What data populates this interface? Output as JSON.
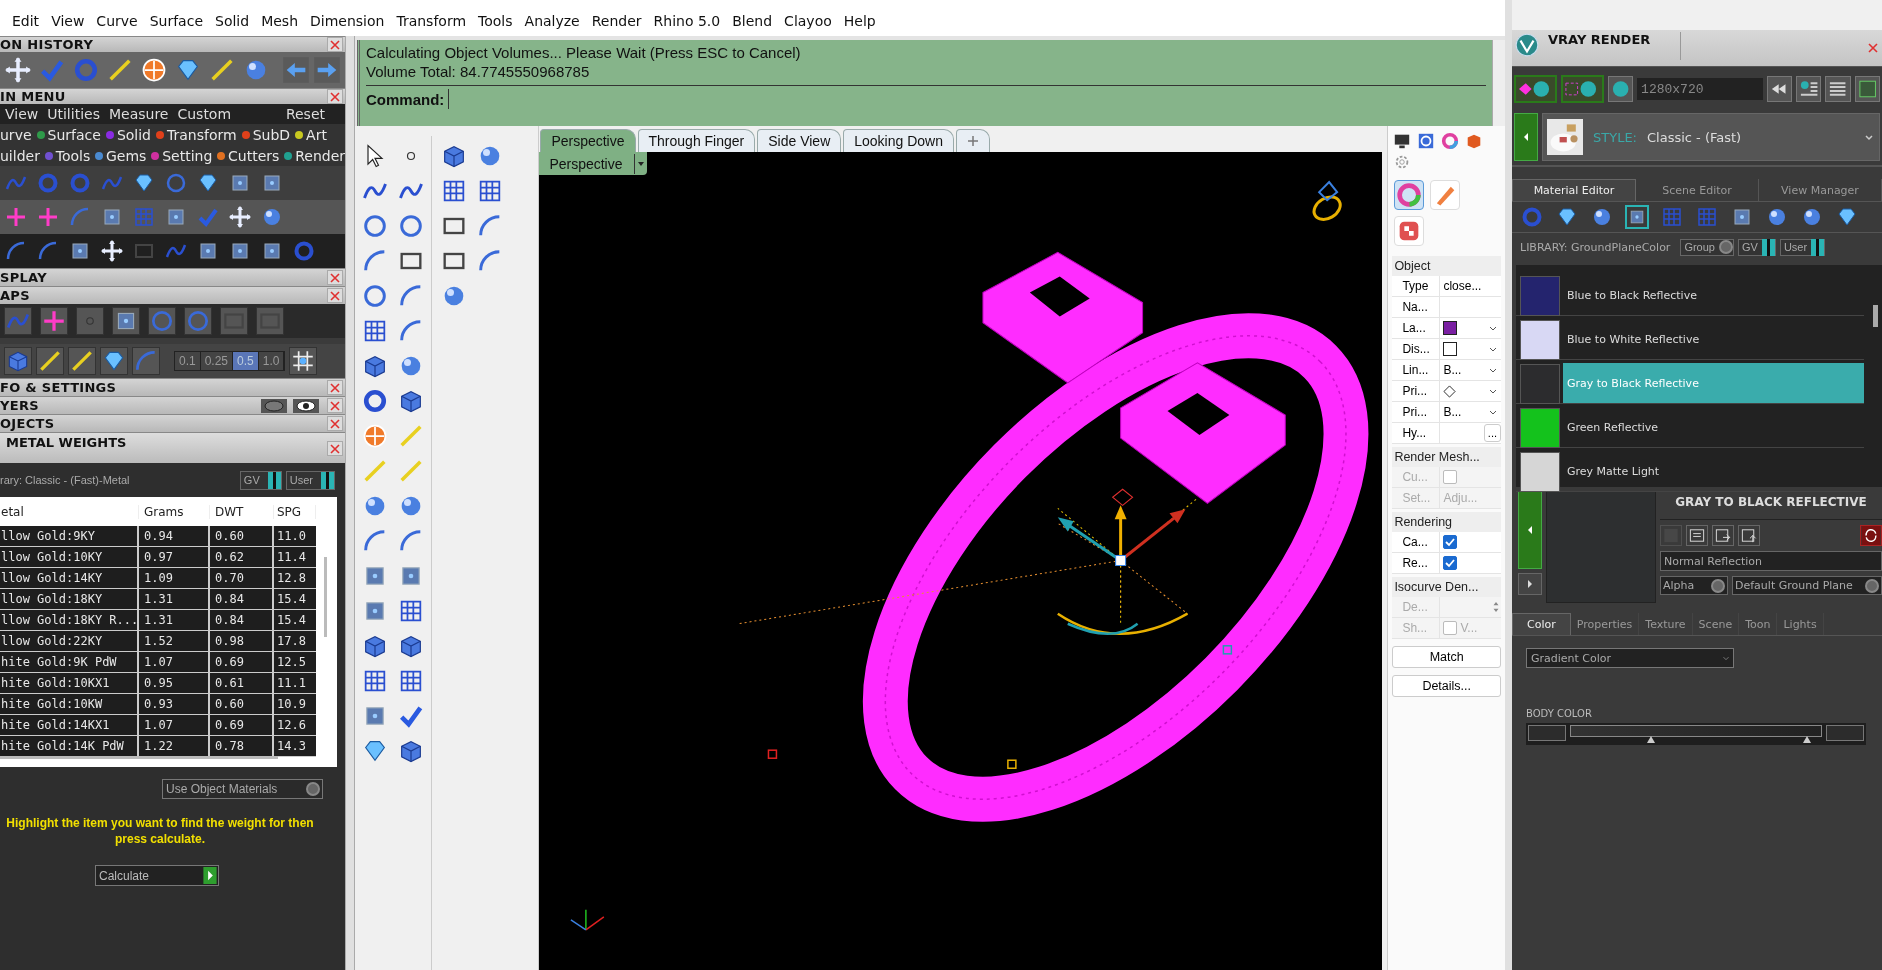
{
  "menu_bar": [
    "Edit",
    "View",
    "Curve",
    "Surface",
    "Solid",
    "Mesh",
    "Dimension",
    "Transform",
    "Tools",
    "Analyze",
    "Render",
    "Rhino 5.0",
    "Blend",
    "Clayoo",
    "Help"
  ],
  "history_panel": {
    "title": "ON HISTORY"
  },
  "main_menu": {
    "title": "IN MENU",
    "menus": [
      "View",
      "Utilities",
      "Measure",
      "Custom"
    ],
    "reset": "Reset",
    "categories": [
      [
        {
          "label": "urve"
        },
        {
          "label": "Surface",
          "color": "#2f9a4a"
        },
        {
          "label": "Solid",
          "color": "#8a2be2"
        },
        {
          "label": "Transform",
          "color": "#e0401a"
        },
        {
          "label": "SubD",
          "color": "#e0401a"
        },
        {
          "label": "Art",
          "color": "#c8c820"
        }
      ],
      [
        {
          "label": "uilder"
        },
        {
          "label": "Tools",
          "color": "#7050d0"
        },
        {
          "label": "Gems",
          "color": "#4a8ad0"
        },
        {
          "label": "Setting",
          "color": "#d030a0"
        },
        {
          "label": "Cutters",
          "color": "#e07020"
        },
        {
          "label": "Render",
          "color": "#20a090"
        }
      ]
    ]
  },
  "panels_a": [
    {
      "title": "SPLAY"
    },
    {
      "title": "APS"
    }
  ],
  "snap_steps": [
    {
      "label": "0.1",
      "selected": false
    },
    {
      "label": "0.25",
      "selected": false
    },
    {
      "label": "0.5",
      "selected": true
    },
    {
      "label": "1.0",
      "selected": false
    }
  ],
  "panels_b": [
    {
      "title": "FO & SETTINGS"
    },
    {
      "title": "YERS"
    },
    {
      "title": "OJECTS"
    }
  ],
  "metal_weights": {
    "title": "METAL WEIGHTS",
    "library": "rary: Classic - (Fast)-Metal",
    "toggles": [
      {
        "label": "GV",
        "on": true
      },
      {
        "label": "User",
        "on": true
      }
    ],
    "columns": [
      "etal",
      "Grams",
      "DWT",
      "SPG"
    ],
    "rows": [
      [
        "llow Gold:9KY",
        "0.94",
        "0.60",
        "11.0"
      ],
      [
        "llow Gold:10KY",
        "0.97",
        "0.62",
        "11.4"
      ],
      [
        "llow Gold:14KY",
        "1.09",
        "0.70",
        "12.8"
      ],
      [
        "llow Gold:18KY",
        "1.31",
        "0.84",
        "15.4"
      ],
      [
        "llow Gold:18KY R...",
        "1.31",
        "0.84",
        "15.4"
      ],
      [
        "llow Gold:22KY",
        "1.52",
        "0.98",
        "17.8"
      ],
      [
        "hite Gold:9K PdW",
        "1.07",
        "0.69",
        "12.5"
      ],
      [
        "hite Gold:10KX1",
        "0.95",
        "0.61",
        "11.1"
      ],
      [
        "hite Gold:10KW",
        "0.93",
        "0.60",
        "10.9"
      ],
      [
        "hite Gold:14KX1",
        "1.07",
        "0.69",
        "12.6"
      ],
      [
        "hite Gold:14K PdW",
        "1.22",
        "0.78",
        "14.3"
      ]
    ],
    "use_materials": {
      "label": "Use Object Materials",
      "on": false
    },
    "hint": "Highlight the item you want to find the weight for then press calculate.",
    "calculate": "Calculate"
  },
  "command": {
    "lines": [
      "Calculating Object Volumes... Please Wait (Press ESC to Cancel)",
      "Volume Total: 84.7745550968785"
    ],
    "prompt": "Command:"
  },
  "viewport_tabs": [
    {
      "label": "Perspective",
      "selected": true
    },
    {
      "label": "Through Finger",
      "selected": false
    },
    {
      "label": "Side View",
      "selected": false
    },
    {
      "label": "Looking Down",
      "selected": false
    }
  ],
  "viewport": {
    "label": "Perspective"
  },
  "properties": {
    "sections": [
      {
        "title": "Object",
        "rows": [
          {
            "kind": "text",
            "label": "Type",
            "value": "close..."
          },
          {
            "kind": "text",
            "label": "Na..."
          },
          {
            "kind": "swatch",
            "label": "La...",
            "color": "#7a1fa2"
          },
          {
            "kind": "swatch",
            "label": "Dis...",
            "color": "#ffffff"
          },
          {
            "kind": "choice",
            "label": "Lin...",
            "value": "B..."
          },
          {
            "kind": "diamond",
            "label": "Pri..."
          },
          {
            "kind": "choice",
            "label": "Pri...",
            "value": "B..."
          },
          {
            "kind": "more",
            "label": "Hy...",
            "value": "..."
          }
        ]
      },
      {
        "title": "Render Mesh...",
        "rows": [
          {
            "kind": "check",
            "label": "Cu...",
            "checked": false,
            "disabled": true
          },
          {
            "kind": "text",
            "label": "Set...",
            "value": "Adju...",
            "disabled": true
          }
        ]
      },
      {
        "title": "Rendering",
        "rows": [
          {
            "kind": "check",
            "label": "Ca...",
            "checked": true,
            "disabled": false
          },
          {
            "kind": "check",
            "label": "Re...",
            "checked": true,
            "disabled": false
          }
        ]
      },
      {
        "title": "Isocurve Den...",
        "rows": [
          {
            "kind": "spin",
            "label": "De...",
            "disabled": true
          },
          {
            "kind": "check",
            "label": "Sh...",
            "checked": false,
            "disabled": true,
            "value": "V..."
          }
        ]
      }
    ],
    "buttons": [
      "Match",
      "Details..."
    ]
  },
  "vray": {
    "title": "VRAY RENDER",
    "resolution": "1280x720",
    "style_label": "STYLE:",
    "style": "Classic - (Fast)",
    "tabs": [
      {
        "label": "Material Editor",
        "selected": true
      },
      {
        "label": "Scene Editor",
        "selected": false
      },
      {
        "label": "View Manager",
        "selected": false
      }
    ],
    "library": "LIBRARY: GroundPlaneColor",
    "toggles": [
      {
        "label": "Group",
        "on": false
      },
      {
        "label": "GV",
        "on": true
      },
      {
        "label": "User",
        "on": true
      }
    ],
    "materials": [
      {
        "name": "Blue to Black Reflective",
        "color": "#24246e",
        "selected": false
      },
      {
        "name": "Blue to White Reflective",
        "color": "#d8d8f4",
        "selected": false
      },
      {
        "name": "Gray to Black Reflective",
        "color": "#2c2c2e",
        "selected": true
      },
      {
        "name": "Green Reflective",
        "color": "#14c21c",
        "selected": false
      },
      {
        "name": "Grey Matte Light",
        "color": "#d6d6d6",
        "selected": false
      }
    ],
    "material_title": "GRAY TO BLACK REFLECTIVE",
    "reflection": "Normal Reflection",
    "options": [
      {
        "label": "Alpha",
        "on": false
      },
      {
        "label": "Default Ground Plane",
        "on": false
      }
    ],
    "detail_tabs": [
      {
        "label": "Color",
        "selected": true
      },
      {
        "label": "Properties",
        "selected": false
      },
      {
        "label": "Texture",
        "selected": false
      },
      {
        "label": "Scene",
        "selected": false
      },
      {
        "label": "Toon",
        "selected": false
      },
      {
        "label": "Lights",
        "selected": false
      }
    ],
    "color_mode": "Gradient Color",
    "body_color": "BODY COLOR"
  }
}
